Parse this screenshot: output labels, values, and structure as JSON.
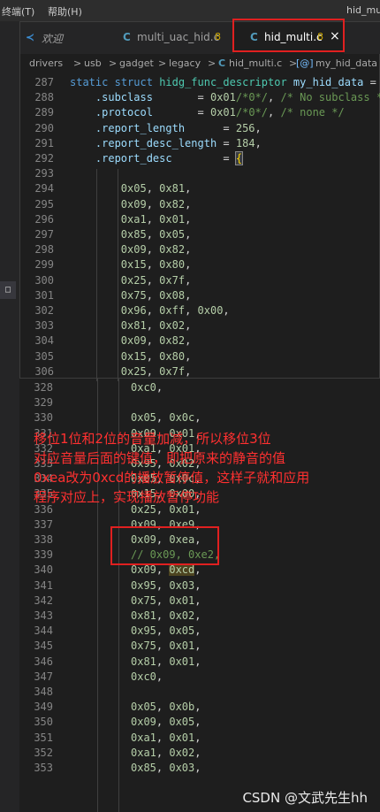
{
  "menubar": {
    "items": [
      "终端(T)",
      "帮助(H)"
    ],
    "title_fragment": "hid_mult"
  },
  "tabs": [
    {
      "label": "欢迎",
      "icon": "vscode-icon",
      "active": false
    },
    {
      "label": "multi_uac_hid.c",
      "icon": "c-file-icon",
      "badge": "8",
      "active": false
    },
    {
      "label": "hid_multi.c",
      "icon": "c-file-icon",
      "badge": "8",
      "active": true,
      "close": "×"
    }
  ],
  "breadcrumb": [
    "drivers",
    ">",
    "usb",
    ">",
    "gadget",
    ">",
    "legacy",
    ">",
    "C",
    "hid_multi.c",
    ">",
    "[@]",
    "my_hid_data"
  ],
  "top_code": [
    {
      "n": "287",
      "t": "static struct hidg_func_descriptor my_hid_data = {"
    },
    {
      "n": "288",
      "t": "    .subclass       = 0x01/*0*/, /* No subclass */"
    },
    {
      "n": "289",
      "t": "    .protocol       = 0x01/*0*/, /* none */"
    },
    {
      "n": "290",
      "t": "    .report_length      = 256,"
    },
    {
      "n": "291",
      "t": "    .report_desc_length = 184,"
    },
    {
      "n": "292",
      "t": "    .report_desc        = {"
    },
    {
      "n": "293",
      "t": ""
    },
    {
      "n": "294",
      "t": "        0x05, 0x81,"
    },
    {
      "n": "295",
      "t": "        0x09, 0x82,"
    },
    {
      "n": "296",
      "t": "        0xa1, 0x01,"
    },
    {
      "n": "297",
      "t": "        0x85, 0x05,"
    },
    {
      "n": "298",
      "t": "        0x09, 0x82,"
    },
    {
      "n": "299",
      "t": "        0x15, 0x80,"
    },
    {
      "n": "300",
      "t": "        0x25, 0x7f,"
    },
    {
      "n": "301",
      "t": "        0x75, 0x08,"
    },
    {
      "n": "302",
      "t": "        0x96, 0xff, 0x00,"
    },
    {
      "n": "303",
      "t": "        0x81, 0x02,"
    },
    {
      "n": "304",
      "t": "        0x09, 0x82,"
    },
    {
      "n": "305",
      "t": "        0x15, 0x80,"
    },
    {
      "n": "306",
      "t": "        0x25, 0x7f,"
    }
  ],
  "bottom_code": [
    {
      "n": "328",
      "t": "0xc0,"
    },
    {
      "n": "329",
      "t": ""
    },
    {
      "n": "330",
      "t": "0x05, 0x0c,"
    },
    {
      "n": "331",
      "t": "0x09, 0x01,"
    },
    {
      "n": "332",
      "t": "0xa1, 0x01,"
    },
    {
      "n": "333",
      "t": "0x95, 0x02,"
    },
    {
      "n": "334",
      "t": "0x05, 0x0c,"
    },
    {
      "n": "335",
      "t": "0x15, 0x00,"
    },
    {
      "n": "336",
      "t": "0x25, 0x01,"
    },
    {
      "n": "337",
      "t": "0x09, 0xe9,"
    },
    {
      "n": "338",
      "t": "0x09, 0xea,"
    },
    {
      "n": "339",
      "t": "// 0x09, 0xe2,"
    },
    {
      "n": "340",
      "t": "0x09, 0xcd,"
    },
    {
      "n": "341",
      "t": "0x95, 0x03,"
    },
    {
      "n": "342",
      "t": "0x75, 0x01,"
    },
    {
      "n": "343",
      "t": "0x81, 0x02,"
    },
    {
      "n": "344",
      "t": "0x95, 0x05,"
    },
    {
      "n": "345",
      "t": "0x75, 0x01,"
    },
    {
      "n": "346",
      "t": "0x81, 0x01,"
    },
    {
      "n": "347",
      "t": "0xc0,"
    },
    {
      "n": "348",
      "t": ""
    },
    {
      "n": "349",
      "t": "0x05, 0x0b,"
    },
    {
      "n": "350",
      "t": "0x09, 0x05,"
    },
    {
      "n": "351",
      "t": "0xa1, 0x01,"
    },
    {
      "n": "352",
      "t": "0xa1, 0x02,"
    },
    {
      "n": "353",
      "t": "0x85, 0x03,"
    }
  ],
  "annotation": [
    "移位1位和2位的音量加减，所以移位3位",
    "对应音量后面的键值，即把原来的静音的值",
    "0xea改为0xcd的播放暂停值，这样子就和应用",
    "程序对应上，实现播放暂停功能"
  ],
  "watermark": "CSDN @文武先生hh",
  "colors": {
    "annotation": "#ff3030",
    "box": "#e02020",
    "keyword": "#569cd6",
    "number": "#b5cea8",
    "comment": "#6a9955"
  }
}
